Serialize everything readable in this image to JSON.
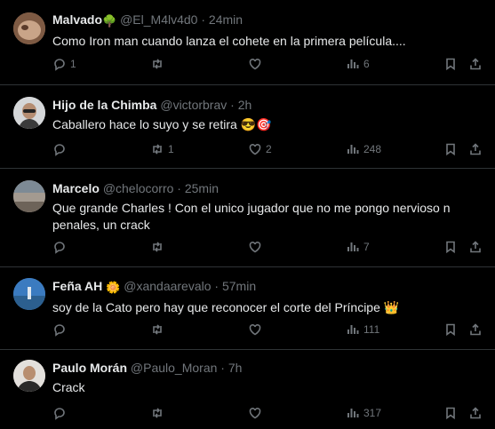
{
  "tweets": [
    {
      "name": "Malvado",
      "name_emoji": "🌳",
      "handle": "@El_M4lv4d0",
      "time": "24min",
      "text": "Como Iron man cuando lanza el cohete en la primera película....",
      "replies": "1",
      "retweets": "",
      "likes": "",
      "views": "6",
      "avatar_color": "#b48a6a"
    },
    {
      "name": "Hijo de la Chimba",
      "name_emoji": "",
      "handle": "@victorbrav",
      "time": "2h",
      "text": "Caballero hace lo suyo y se retira 😎🎯",
      "replies": "",
      "retweets": "1",
      "likes": "2",
      "views": "248",
      "avatar_color": "#cfd3d6"
    },
    {
      "name": "Marcelo",
      "name_emoji": "",
      "handle": "@chelocorro",
      "time": "25min",
      "text": "Que grande Charles ! Con el unico jugador que no me pongo nervioso n penales, un crack",
      "replies": "",
      "retweets": "",
      "likes": "",
      "views": "7",
      "avatar_color": "#9a9187"
    },
    {
      "name": "Feña AH",
      "name_emoji": "🌼",
      "handle": "@xandaarevalo",
      "time": "57min",
      "text": "soy de la Cato pero hay que reconocer el corte del Príncipe 👑",
      "replies": "",
      "retweets": "",
      "likes": "",
      "views": "111",
      "avatar_color": "#4a86c5"
    },
    {
      "name": "Paulo Morán",
      "name_emoji": "",
      "handle": "@Paulo_Moran",
      "time": "7h",
      "text": "Crack",
      "replies": "",
      "retweets": "",
      "likes": "",
      "views": "317",
      "avatar_color": "#d8d3cc"
    }
  ],
  "separator": "·"
}
